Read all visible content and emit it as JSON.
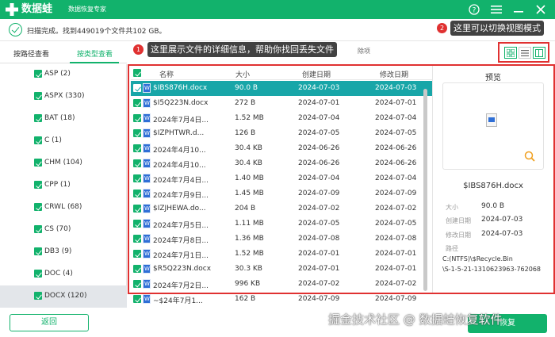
{
  "app": {
    "name": "数据蛙",
    "subtitle": "数据恢复专家",
    "brand_color": "#12b26c"
  },
  "titlebar": {
    "help_icon": "help-icon",
    "menu_icon": "menu-icon",
    "minimize_icon": "minimize-icon",
    "close_icon": "close-icon"
  },
  "status": {
    "text": "扫描完成。找到449019个文件共102 GB。"
  },
  "tabs": [
    {
      "label": "按路径查看",
      "active": false
    },
    {
      "label": "按类型查看",
      "active": true
    }
  ],
  "annotations": {
    "first": {
      "badge": "1",
      "text": "这里展示文件的详细信息，帮助你找回丢失文件"
    },
    "second": {
      "badge": "2",
      "text": "这里可以切换视图模式"
    },
    "trailing_text": "除项",
    "color": "#e03131"
  },
  "view_modes": [
    "grid-view-icon",
    "list-view-icon",
    "detail-view-icon"
  ],
  "sidebar": {
    "items": [
      {
        "label": "ASP (2)"
      },
      {
        "label": "ASPX (330)"
      },
      {
        "label": "BAT (18)"
      },
      {
        "label": "C (1)"
      },
      {
        "label": "CHM (104)"
      },
      {
        "label": "CPP (1)"
      },
      {
        "label": "CRWL (68)"
      },
      {
        "label": "CS (70)"
      },
      {
        "label": "DB3 (9)"
      },
      {
        "label": "DOC (4)"
      },
      {
        "label": "DOCX (120)"
      }
    ]
  },
  "table": {
    "headers": {
      "name": "名称",
      "size": "大小",
      "created": "创建日期",
      "modified": "修改日期"
    },
    "rows": [
      {
        "name": "$IBS876H.docx",
        "size": "90.0  B",
        "created": "2024-07-03",
        "modified": "2024-07-03"
      },
      {
        "name": "$I5Q223N.docx",
        "size": "272  B",
        "created": "2024-07-01",
        "modified": "2024-07-01"
      },
      {
        "name": "2024年7月4日...",
        "size": "1.52 MB",
        "created": "2024-07-04",
        "modified": "2024-07-04"
      },
      {
        "name": "$IZPHTWR.d...",
        "size": "126  B",
        "created": "2024-07-05",
        "modified": "2024-07-05"
      },
      {
        "name": "2024年4月10...",
        "size": "30.4 KB",
        "created": "2024-06-26",
        "modified": "2024-06-26"
      },
      {
        "name": "2024年4月10...",
        "size": "30.4 KB",
        "created": "2024-06-26",
        "modified": "2024-06-26"
      },
      {
        "name": "2024年7月4日...",
        "size": "1.40 MB",
        "created": "2024-07-04",
        "modified": "2024-07-04"
      },
      {
        "name": "2024年7月9日...",
        "size": "1.45 MB",
        "created": "2024-07-09",
        "modified": "2024-07-09"
      },
      {
        "name": "$IZJHEWA.do...",
        "size": "204  B",
        "created": "2024-07-02",
        "modified": "2024-07-02"
      },
      {
        "name": "2024年7月5日...",
        "size": "1.11 MB",
        "created": "2024-07-05",
        "modified": "2024-07-05"
      },
      {
        "name": "2024年7月8日...",
        "size": "1.36 MB",
        "created": "2024-07-08",
        "modified": "2024-07-08"
      },
      {
        "name": "2024年7月1日...",
        "size": "1.52 MB",
        "created": "2024-07-01",
        "modified": "2024-07-01"
      },
      {
        "name": "$R5Q223N.docx",
        "size": "30.3 KB",
        "created": "2024-07-01",
        "modified": "2024-07-01"
      },
      {
        "name": "2024年7月2日...",
        "size": "996 KB",
        "created": "2024-07-02",
        "modified": "2024-07-02"
      },
      {
        "name": "~$24年7月1...",
        "size": "162  B",
        "created": "2024-07-09",
        "modified": "2024-07-09"
      }
    ]
  },
  "preview": {
    "title": "预览",
    "file_name": "$IBS876H.docx",
    "size_label": "大小",
    "size": "90.0  B",
    "created_label": "创建日期",
    "created": "2024-07-03",
    "modified_label": "修改日期",
    "modified": "2024-07-03",
    "path_label": "路径",
    "path_line1": "C:(NTFS)\\$Recycle.Bin",
    "path_line2": "\\S-1-5-21-1310623963-762068"
  },
  "footer": {
    "back_label": "返回",
    "recover_label": "恢复",
    "watermark": "掘金技术社区 @ 数据蛙恢复软件"
  }
}
